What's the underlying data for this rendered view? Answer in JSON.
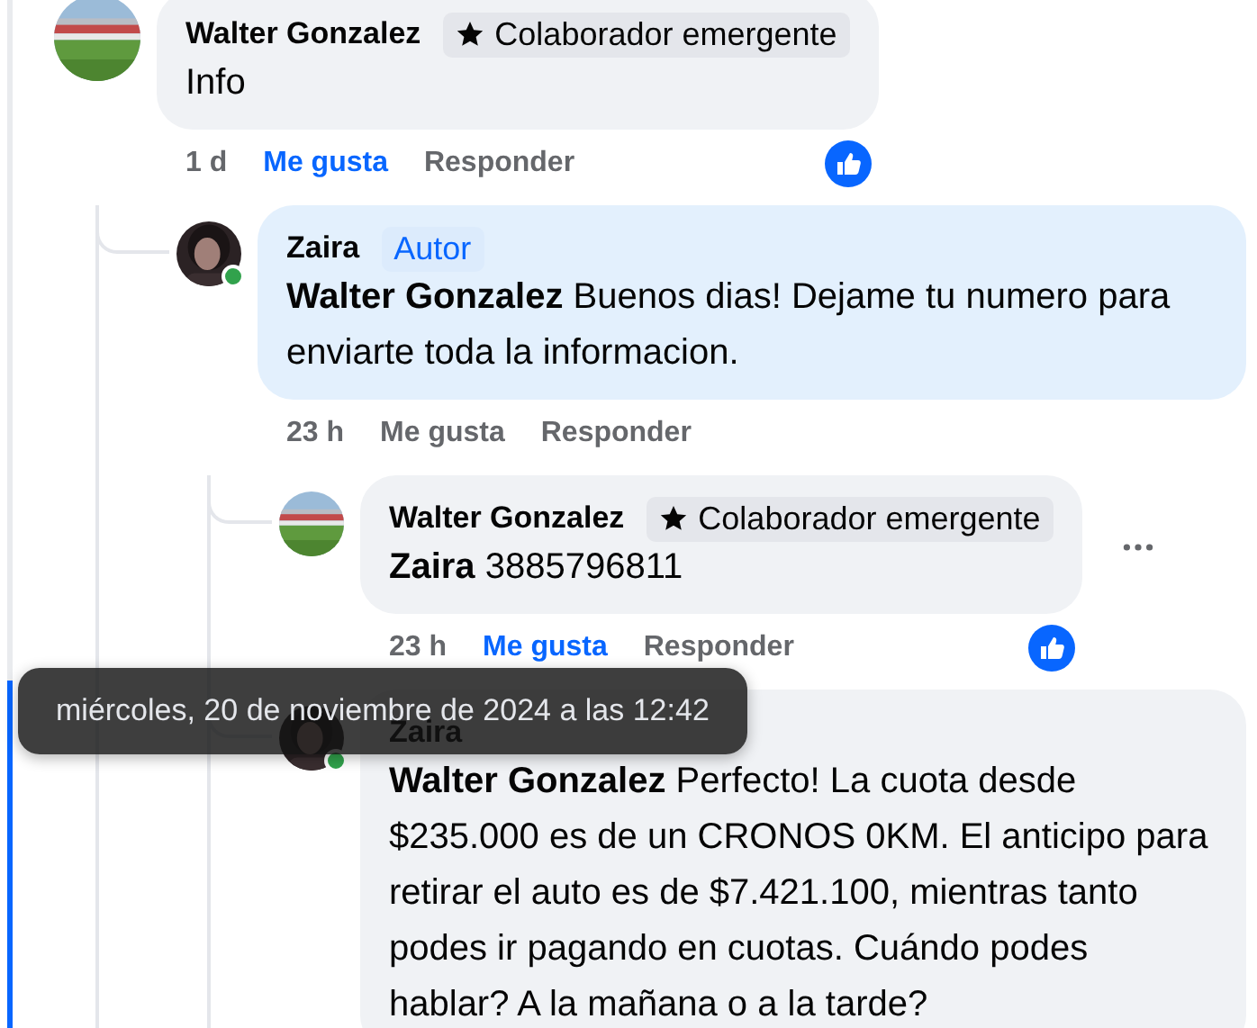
{
  "comments": [
    {
      "author": "Walter Gonzalez",
      "online": false,
      "badge": {
        "kind": "top-contributor",
        "label": "Colaborador emergente"
      },
      "tinted": false,
      "text": "Info",
      "time": "1 d",
      "like_label": "Me gusta",
      "liked": true,
      "reply_label": "Responder",
      "reaction": true,
      "more_menu": false,
      "highlighted": false,
      "children": [
        {
          "author": "Zaira",
          "online": true,
          "badge": {
            "kind": "author",
            "label": "Autor"
          },
          "tinted": true,
          "mention": "Walter Gonzalez",
          "text": "Buenos dias! Dejame tu numero para enviarte toda la informacion.",
          "time": "23 h",
          "like_label": "Me gusta",
          "liked": false,
          "reply_label": "Responder",
          "reaction": false,
          "more_menu": false,
          "highlighted": false,
          "children": [
            {
              "author": "Walter Gonzalez",
              "online": false,
              "badge": {
                "kind": "top-contributor",
                "label": "Colaborador emergente"
              },
              "tinted": false,
              "mention": "Zaira",
              "text": "3885796811",
              "time": "23 h",
              "like_label": "Me gusta",
              "liked": true,
              "reply_label": "Responder",
              "reaction": true,
              "more_menu": true,
              "highlighted": false
            },
            {
              "author": "Zaira",
              "online": true,
              "tinted": false,
              "mention": "Walter Gonzalez",
              "text": "Perfecto! La cuota desde $235.000 es de un CRONOS 0KM. El anticipo para retirar el auto es de $7.421.100, mientras tanto podes ir pagando en cuotas. Cuándo podes hablar? A la mañana o a la tarde?",
              "more_menu": false,
              "highlighted": true,
              "tooltip": "miércoles, 20 de noviembre de 2024 a las 12:42"
            }
          ]
        }
      ]
    }
  ]
}
